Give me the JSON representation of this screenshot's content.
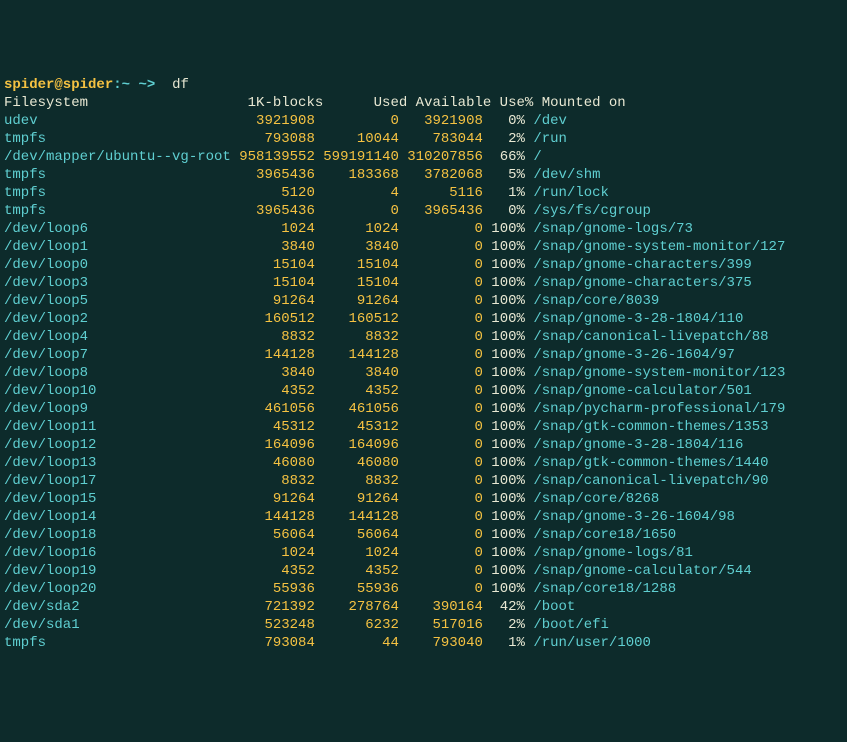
{
  "prompt": {
    "user": "spider",
    "host": "spider",
    "sep": ":",
    "path": "~",
    "arrow": "~>",
    "command": "df"
  },
  "header": {
    "filesystem": "Filesystem",
    "blocks": "1K-blocks",
    "used": "Used",
    "available": "Available",
    "usepct": "Use%",
    "mount": "Mounted on"
  },
  "rows": [
    {
      "fs": "udev",
      "blocks": "3921908",
      "used": "0",
      "avail": "3921908",
      "pct": "0%",
      "mnt": "/dev"
    },
    {
      "fs": "tmpfs",
      "blocks": "793088",
      "used": "10044",
      "avail": "783044",
      "pct": "2%",
      "mnt": "/run"
    },
    {
      "fs": "/dev/mapper/ubuntu--vg-root",
      "blocks": "958139552",
      "used": "599191140",
      "avail": "310207856",
      "pct": "66%",
      "mnt": "/"
    },
    {
      "fs": "tmpfs",
      "blocks": "3965436",
      "used": "183368",
      "avail": "3782068",
      "pct": "5%",
      "mnt": "/dev/shm"
    },
    {
      "fs": "tmpfs",
      "blocks": "5120",
      "used": "4",
      "avail": "5116",
      "pct": "1%",
      "mnt": "/run/lock"
    },
    {
      "fs": "tmpfs",
      "blocks": "3965436",
      "used": "0",
      "avail": "3965436",
      "pct": "0%",
      "mnt": "/sys/fs/cgroup"
    },
    {
      "fs": "/dev/loop6",
      "blocks": "1024",
      "used": "1024",
      "avail": "0",
      "pct": "100%",
      "mnt": "/snap/gnome-logs/73"
    },
    {
      "fs": "/dev/loop1",
      "blocks": "3840",
      "used": "3840",
      "avail": "0",
      "pct": "100%",
      "mnt": "/snap/gnome-system-monitor/127"
    },
    {
      "fs": "/dev/loop0",
      "blocks": "15104",
      "used": "15104",
      "avail": "0",
      "pct": "100%",
      "mnt": "/snap/gnome-characters/399"
    },
    {
      "fs": "/dev/loop3",
      "blocks": "15104",
      "used": "15104",
      "avail": "0",
      "pct": "100%",
      "mnt": "/snap/gnome-characters/375"
    },
    {
      "fs": "/dev/loop5",
      "blocks": "91264",
      "used": "91264",
      "avail": "0",
      "pct": "100%",
      "mnt": "/snap/core/8039"
    },
    {
      "fs": "/dev/loop2",
      "blocks": "160512",
      "used": "160512",
      "avail": "0",
      "pct": "100%",
      "mnt": "/snap/gnome-3-28-1804/110"
    },
    {
      "fs": "/dev/loop4",
      "blocks": "8832",
      "used": "8832",
      "avail": "0",
      "pct": "100%",
      "mnt": "/snap/canonical-livepatch/88"
    },
    {
      "fs": "/dev/loop7",
      "blocks": "144128",
      "used": "144128",
      "avail": "0",
      "pct": "100%",
      "mnt": "/snap/gnome-3-26-1604/97"
    },
    {
      "fs": "/dev/loop8",
      "blocks": "3840",
      "used": "3840",
      "avail": "0",
      "pct": "100%",
      "mnt": "/snap/gnome-system-monitor/123"
    },
    {
      "fs": "/dev/loop10",
      "blocks": "4352",
      "used": "4352",
      "avail": "0",
      "pct": "100%",
      "mnt": "/snap/gnome-calculator/501"
    },
    {
      "fs": "/dev/loop9",
      "blocks": "461056",
      "used": "461056",
      "avail": "0",
      "pct": "100%",
      "mnt": "/snap/pycharm-professional/179"
    },
    {
      "fs": "/dev/loop11",
      "blocks": "45312",
      "used": "45312",
      "avail": "0",
      "pct": "100%",
      "mnt": "/snap/gtk-common-themes/1353"
    },
    {
      "fs": "/dev/loop12",
      "blocks": "164096",
      "used": "164096",
      "avail": "0",
      "pct": "100%",
      "mnt": "/snap/gnome-3-28-1804/116"
    },
    {
      "fs": "/dev/loop13",
      "blocks": "46080",
      "used": "46080",
      "avail": "0",
      "pct": "100%",
      "mnt": "/snap/gtk-common-themes/1440"
    },
    {
      "fs": "/dev/loop17",
      "blocks": "8832",
      "used": "8832",
      "avail": "0",
      "pct": "100%",
      "mnt": "/snap/canonical-livepatch/90"
    },
    {
      "fs": "/dev/loop15",
      "blocks": "91264",
      "used": "91264",
      "avail": "0",
      "pct": "100%",
      "mnt": "/snap/core/8268"
    },
    {
      "fs": "/dev/loop14",
      "blocks": "144128",
      "used": "144128",
      "avail": "0",
      "pct": "100%",
      "mnt": "/snap/gnome-3-26-1604/98"
    },
    {
      "fs": "/dev/loop18",
      "blocks": "56064",
      "used": "56064",
      "avail": "0",
      "pct": "100%",
      "mnt": "/snap/core18/1650"
    },
    {
      "fs": "/dev/loop16",
      "blocks": "1024",
      "used": "1024",
      "avail": "0",
      "pct": "100%",
      "mnt": "/snap/gnome-logs/81"
    },
    {
      "fs": "/dev/loop19",
      "blocks": "4352",
      "used": "4352",
      "avail": "0",
      "pct": "100%",
      "mnt": "/snap/gnome-calculator/544"
    },
    {
      "fs": "/dev/loop20",
      "blocks": "55936",
      "used": "55936",
      "avail": "0",
      "pct": "100%",
      "mnt": "/snap/core18/1288"
    },
    {
      "fs": "/dev/sda2",
      "blocks": "721392",
      "used": "278764",
      "avail": "390164",
      "pct": "42%",
      "mnt": "/boot"
    },
    {
      "fs": "/dev/sda1",
      "blocks": "523248",
      "used": "6232",
      "avail": "517016",
      "pct": "2%",
      "mnt": "/boot/efi"
    },
    {
      "fs": "tmpfs",
      "blocks": "793084",
      "used": "44",
      "avail": "793040",
      "pct": "1%",
      "mnt": "/run/user/1000"
    }
  ],
  "widths": {
    "fs": 27,
    "blocks": 10,
    "used": 10,
    "avail": 10,
    "pct": 5
  }
}
